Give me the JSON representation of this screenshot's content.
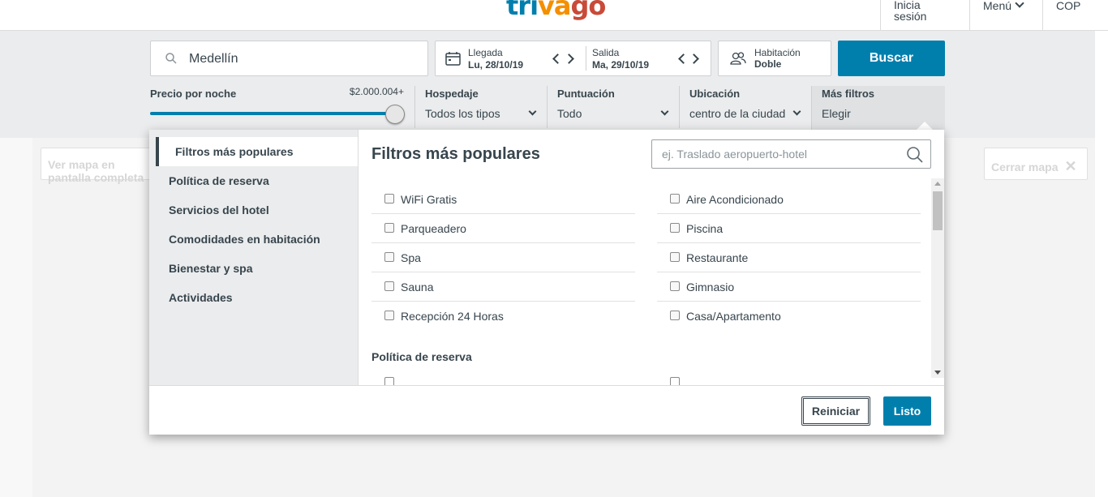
{
  "header": {
    "logo": {
      "part1": "tri",
      "part2": "va",
      "part3": "go"
    },
    "login": "Inicia sesión",
    "menu": "Menú",
    "currency": "COP"
  },
  "search": {
    "destination": "Medellín",
    "checkin_label": "Llegada",
    "checkin_value": "Lu, 28/10/19",
    "checkout_label": "Salida",
    "checkout_value": "Ma, 29/10/19",
    "room_label": "Habitación",
    "room_value": "Doble",
    "search_button": "Buscar"
  },
  "price": {
    "label": "Precio por noche",
    "amount": "$2.000.004+",
    "slider_fraction": 1.0
  },
  "filters": [
    {
      "label": "Hospedaje",
      "value": "Todos los tipos"
    },
    {
      "label": "Puntuación",
      "value": "Todo"
    },
    {
      "label": "Ubicación",
      "value": "centro de la ciudad"
    },
    {
      "label": "Más filtros",
      "value": "Elegir"
    }
  ],
  "map": {
    "fullscreen": "Ver mapa en pantalla completa",
    "close": "Cerrar mapa"
  },
  "modal": {
    "sidebar": [
      "Filtros más populares",
      "Política de reserva",
      "Servicios del hotel",
      "Comodidades en habitación",
      "Bienestar y spa",
      "Actividades"
    ],
    "title": "Filtros más populares",
    "search_placeholder": "ej. Traslado aeropuerto-hotel",
    "options_left": [
      "WiFi Gratis",
      "Parqueadero",
      "Spa",
      "Sauna",
      "Recepción 24 Horas"
    ],
    "options_right": [
      "Aire Acondicionado",
      "Piscina",
      "Restaurante",
      "Gimnasio",
      "Casa/Apartamento"
    ],
    "subheading": "Política de reserva",
    "reset_button": "Reiniciar",
    "done_button": "Listo"
  }
}
